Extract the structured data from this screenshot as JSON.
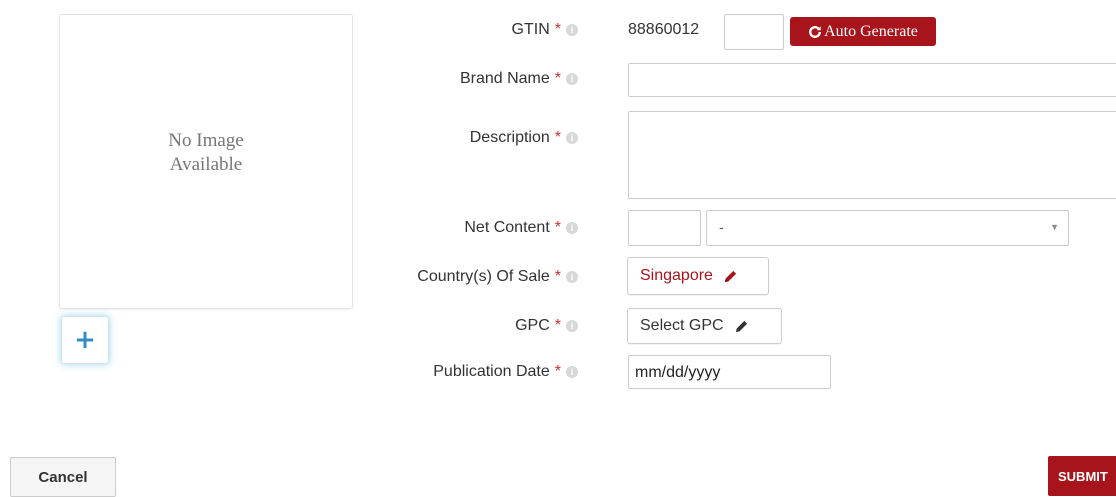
{
  "image": {
    "placeholder_line1": "No Image",
    "placeholder_line2": "Available",
    "add_label": "+"
  },
  "form": {
    "required_mark": "*",
    "info_glyph": "i",
    "gtin": {
      "label": "GTIN",
      "prefix": "88860012",
      "suffix_value": "",
      "auto_generate_label": "Auto Generate"
    },
    "brand_name": {
      "label": "Brand Name",
      "value": ""
    },
    "description": {
      "label": "Description",
      "value": ""
    },
    "net_content": {
      "label": "Net Content",
      "amount": "",
      "unit_selected": "-"
    },
    "countries_of_sale": {
      "label": "Country(s) Of Sale",
      "value": "Singapore"
    },
    "gpc": {
      "label": "GPC",
      "value": "Select GPC"
    },
    "publication_date": {
      "label": "Publication Date",
      "value": "mm/dd/yyyy"
    }
  },
  "actions": {
    "cancel_label": "Cancel",
    "submit_label": "SUBMIT"
  },
  "colors": {
    "primary": "#a8141b",
    "required": "#c9302c",
    "accent_blue": "#2f8fc4"
  },
  "icons": {
    "refresh": "refresh-icon",
    "pencil": "pencil-icon",
    "dropdown": "chevron-down-icon"
  }
}
